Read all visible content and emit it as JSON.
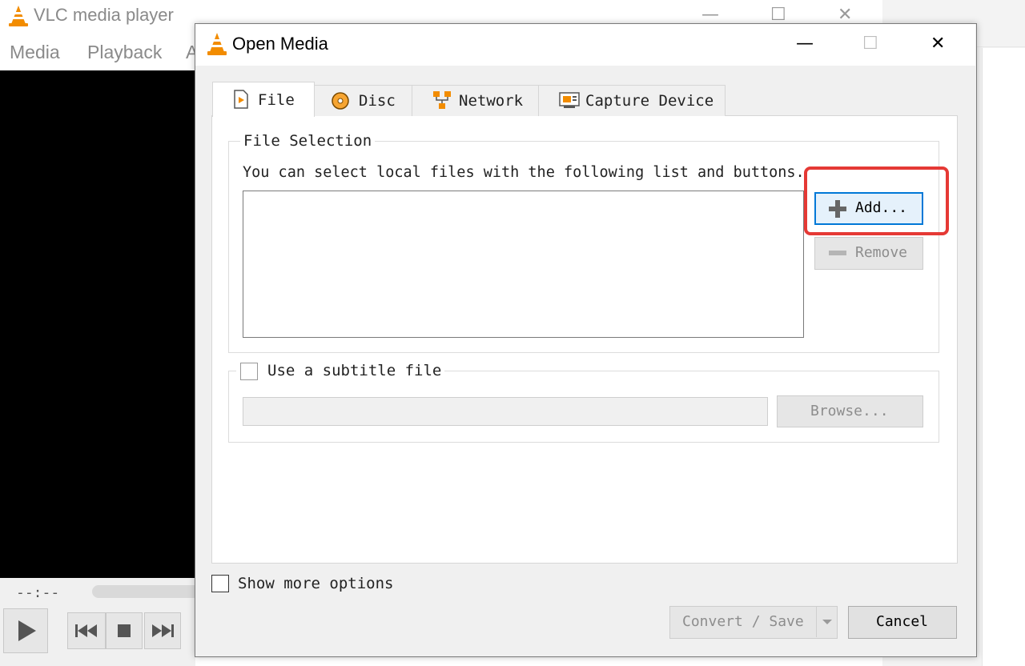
{
  "main_window": {
    "title": "VLC media player",
    "menu": [
      "Media",
      "Playback",
      "A"
    ],
    "time": "--:--",
    "window_controls": {
      "minimize": "—",
      "maximize": "☐",
      "close": "✕"
    }
  },
  "dialog": {
    "title": "Open Media",
    "window_controls": {
      "minimize": "—",
      "maximize": "☐",
      "close": "✕"
    },
    "tabs": [
      {
        "label": "File",
        "icon": "file-play-icon",
        "active": true
      },
      {
        "label": "Disc",
        "icon": "disc-icon",
        "active": false
      },
      {
        "label": "Network",
        "icon": "network-icon",
        "active": false
      },
      {
        "label": "Capture Device",
        "icon": "capture-device-icon",
        "active": false
      }
    ],
    "file_selection": {
      "legend": "File Selection",
      "hint": "You can select local files with the following list and buttons.",
      "add_label": "Add...",
      "remove_label": "Remove"
    },
    "subtitle": {
      "checkbox_label": "Use a subtitle file",
      "path_value": "",
      "browse_label": "Browse..."
    },
    "show_more_label": "Show more options",
    "convert_save_label": "Convert / Save",
    "cancel_label": "Cancel"
  },
  "colors": {
    "highlight": "#e53935",
    "focus_border": "#0078d7",
    "vlc_orange": "#f28c00"
  }
}
